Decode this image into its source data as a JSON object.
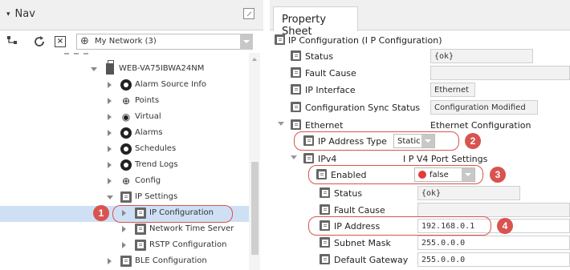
{
  "nav": {
    "title": "Nav",
    "network_select": "My Network (3)",
    "tree": [
      {
        "label": "WEB-VA75IBWA24NM",
        "icon": "station-icon",
        "state": "open"
      },
      {
        "label": "Alarm Source Info",
        "icon": "alarm-source-icon",
        "state": "closed"
      },
      {
        "label": "Points",
        "icon": "points-icon",
        "state": "closed"
      },
      {
        "label": "Virtual",
        "icon": "virtual-icon",
        "state": "closed"
      },
      {
        "label": "Alarms",
        "icon": "alarms-icon",
        "state": "closed"
      },
      {
        "label": "Schedules",
        "icon": "schedules-icon",
        "state": "closed"
      },
      {
        "label": "Trend Logs",
        "icon": "trend-logs-icon",
        "state": "closed"
      },
      {
        "label": "Config",
        "icon": "config-icon",
        "state": "closed"
      },
      {
        "label": "IP Settings",
        "icon": "folder-icon",
        "state": "open"
      },
      {
        "label": "IP Configuration",
        "icon": "folder-icon",
        "state": "closed",
        "selected": true
      },
      {
        "label": "Network Time Server",
        "icon": "folder-icon",
        "state": "closed"
      },
      {
        "label": "RSTP Configuration",
        "icon": "folder-icon",
        "state": "closed"
      },
      {
        "label": "BLE Configuration",
        "icon": "folder-icon",
        "state": "closed"
      }
    ]
  },
  "sheet": {
    "tab": "Property Sheet",
    "root": "IP Configuration  (I P Configuration)",
    "rows": {
      "status": {
        "name": "Status",
        "value": "{ok}"
      },
      "fault_cause": {
        "name": "Fault Cause",
        "value": ""
      },
      "ip_interface": {
        "name": "IP Interface",
        "value": "Ethernet"
      },
      "config_sync": {
        "name": "Configuration Sync Status",
        "value": "Configuration Modified"
      },
      "ethernet": {
        "name": "Ethernet",
        "value": "Ethernet Configuration"
      },
      "ip_address_type": {
        "name": "IP Address Type",
        "value": "Static"
      },
      "ipv4": {
        "name": "IPv4",
        "value": "I P V4 Port Settings"
      },
      "enabled": {
        "name": "Enabled",
        "value": "false"
      },
      "ipv4_status": {
        "name": "Status",
        "value": "{ok}"
      },
      "ipv4_fault_cause": {
        "name": "Fault Cause",
        "value": ""
      },
      "ip_address": {
        "name": "IP Address",
        "value": "192.168.0.1"
      },
      "subnet_mask": {
        "name": "Subnet Mask",
        "value": "255.0.0.0"
      },
      "default_gateway": {
        "name": "Default Gateway",
        "value": "255.0.0.0"
      }
    }
  },
  "callouts": [
    "1",
    "2",
    "3",
    "4"
  ],
  "colors": {
    "callout": "#d9534f",
    "selection": "#cfe0f5",
    "alarm_dot": "#e03c3c"
  }
}
